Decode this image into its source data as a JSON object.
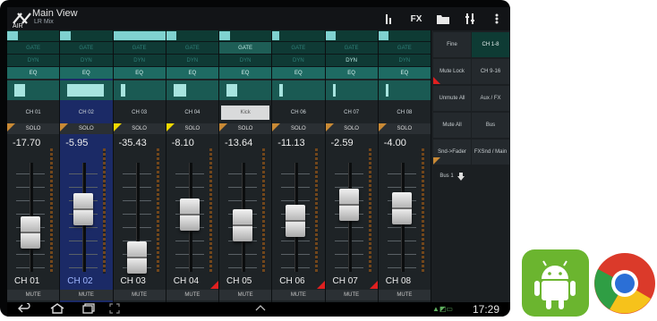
{
  "app": {
    "title": "Main View",
    "subtitle": "LR Mix"
  },
  "toolbar": {
    "fx_label": "FX"
  },
  "strips": [
    {
      "label": "CH 01",
      "bottom": "CH 01",
      "value": "-17.70",
      "gate": "GATE",
      "dyn": "DYN",
      "eq": "EQ",
      "solo": "SOLO",
      "mute": "MUTE",
      "fader": 0.42,
      "eq_bar": 0.2,
      "top_bar": 0.2
    },
    {
      "label": "CH 02",
      "bottom": "CH 02",
      "value": "-5.95",
      "gate": "GATE",
      "dyn": "DYN",
      "eq": "EQ",
      "solo": "SOLO",
      "mute": "MUTE",
      "fader": 0.67,
      "eq_bar": 0.7,
      "top_bar": 0.2
    },
    {
      "label": "CH 03",
      "bottom": "CH 03",
      "value": "-35.43",
      "gate": "GATE",
      "dyn": "DYN",
      "eq": "EQ",
      "solo": "SOLO",
      "mute": "MUTE",
      "fader": 0.15,
      "eq_bar": 0.1,
      "top_bar": 1.0
    },
    {
      "label": "CH 04",
      "bottom": "CH 04",
      "value": "-8.10",
      "gate": "GATE",
      "dyn": "DYN",
      "eq": "EQ",
      "solo": "SOLO",
      "mute": "MUTE",
      "fader": 0.62,
      "eq_bar": 0.25,
      "top_bar": 0.2
    },
    {
      "label": "Kick",
      "bottom": "CH 05",
      "value": "-13.64",
      "gate": "GATE",
      "dyn": "DYN",
      "eq": "EQ",
      "solo": "SOLO",
      "mute": "MUTE",
      "fader": 0.5,
      "eq_bar": 0.2,
      "top_bar": 0.2
    },
    {
      "label": "CH 06",
      "bottom": "CH 06",
      "value": "-11.13",
      "gate": "GATE",
      "dyn": "DYN",
      "eq": "EQ",
      "solo": "SOLO",
      "mute": "MUTE",
      "fader": 0.55,
      "eq_bar": 0.05,
      "top_bar": 0.0
    },
    {
      "label": "CH 07",
      "bottom": "CH 07",
      "value": "-2.59",
      "gate": "GATE",
      "dyn": "DYN",
      "eq": "EQ",
      "solo": "SOLO",
      "mute": "MUTE",
      "fader": 0.72,
      "eq_bar": 0.05,
      "top_bar": 0.2
    },
    {
      "label": "CH 08",
      "bottom": "CH 08",
      "value": "-4.00",
      "gate": "GATE",
      "dyn": "DYN",
      "eq": "EQ",
      "solo": "SOLO",
      "mute": "MUTE",
      "fader": 0.68,
      "eq_bar": 0.05,
      "top_bar": 0.2
    }
  ],
  "side": {
    "fine": "Fine",
    "ch1_8": "CH 1-8",
    "mute_lock": "Mute Lock",
    "ch9_16": "CH 9-16",
    "unmute_all": "Unmute All",
    "aux_fx": "Aux / FX",
    "mute_all": "Mute All",
    "bus": "Bus",
    "snd_fader": "Snd->Fader",
    "fxsnd_main": "FXSnd / Main",
    "bus1": "Bus 1"
  },
  "status": {
    "time": "17:29"
  },
  "colors": {
    "accent": "#0e3b34",
    "selected_strip": "#1b2a66",
    "mute_red": "#e02020",
    "android_green": "#6bb52f"
  }
}
